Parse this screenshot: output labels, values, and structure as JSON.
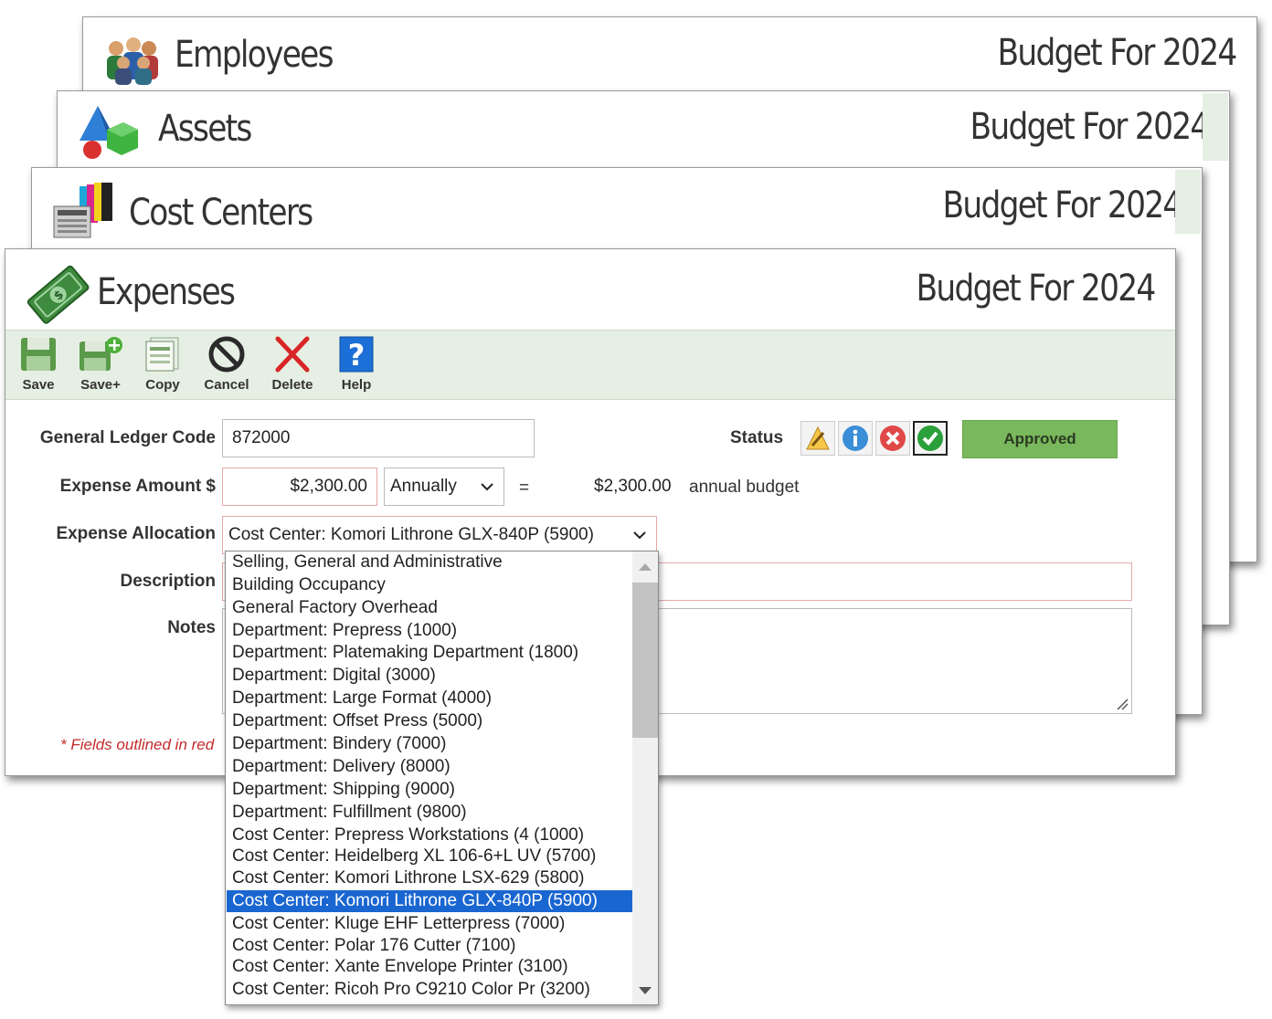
{
  "cards": [
    {
      "title": "Employees",
      "subtitle": "Budget For 2024",
      "icon": "employees-icon"
    },
    {
      "title": "Assets",
      "subtitle": "Budget For 2024",
      "icon": "assets-icon"
    },
    {
      "title": "Cost Centers",
      "subtitle": "Budget For 2024",
      "icon": "cost-centers-icon"
    },
    {
      "title": "Expenses",
      "subtitle": "Budget For 2024",
      "icon": "money-icon"
    }
  ],
  "toolbar": {
    "save": "Save",
    "save_plus": "Save+",
    "copy": "Copy",
    "cancel": "Cancel",
    "delete": "Delete",
    "help": "Help"
  },
  "form": {
    "gl_label": "General Ledger Code",
    "gl_value": "872000",
    "amount_label": "Expense Amount $",
    "amount_value": "$2,300.00",
    "frequency_value": "Annually",
    "equals": "=",
    "annual_value": "$2,300.00",
    "annual_text": "annual budget",
    "allocation_label": "Expense Allocation",
    "allocation_value": "Cost Center: Komori Lithrone GLX-840P (5900)",
    "description_label": "Description",
    "notes_label": "Notes",
    "required_note": "* Fields outlined in red"
  },
  "status": {
    "label": "Status",
    "value": "Approved",
    "colors": {
      "approved": "#79b85c",
      "selected": "#1a66d1"
    }
  },
  "allocation_options": [
    "Selling, General and Administrative",
    "Building Occupancy",
    "General Factory Overhead",
    "Department: Prepress (1000)",
    "Department: Platemaking Department (1800)",
    "Department: Digital (3000)",
    "Department: Large Format (4000)",
    "Department: Offset Press (5000)",
    "Department: Bindery (7000)",
    "Department: Delivery (8000)",
    "Department: Shipping (9000)",
    "Department: Fulfillment (9800)",
    "Cost Center: Prepress Workstations (4 (1000)",
    "Cost Center: Heidelberg XL 106-6+L UV (5700)",
    "Cost Center: Komori Lithrone LSX-629 (5800)",
    "Cost Center: Komori Lithrone GLX-840P (5900)",
    "Cost Center: Kluge EHF Letterpress (7000)",
    "Cost Center: Polar 176 Cutter (7100)",
    "Cost Center: Xante Envelope Printer (3100)",
    "Cost Center: Ricoh Pro C9210 Color Pr (3200)"
  ],
  "selected_option_index": 15
}
